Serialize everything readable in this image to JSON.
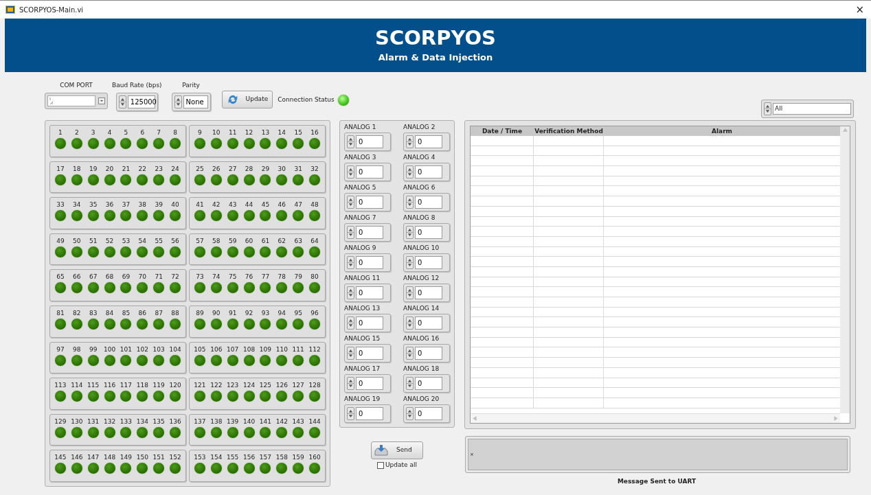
{
  "window": {
    "title": "SCORPYOS-Main.vi",
    "close": "×"
  },
  "header": {
    "title": "SCORPYOS",
    "subtitle": "Alarm & Data Injection"
  },
  "serial": {
    "com_port": {
      "label": "COM PORT"
    },
    "baud_rate": {
      "label": "Baud Rate (bps)",
      "value": "125000"
    },
    "parity": {
      "label": "Parity",
      "value": "None"
    },
    "update_button": "Update",
    "connection_status": {
      "label": "Connection Status",
      "on": true
    }
  },
  "led_groups": [
    {
      "leds": [
        {
          "label": "1",
          "on": false
        },
        {
          "label": "2",
          "on": false
        },
        {
          "label": "3",
          "on": false
        },
        {
          "label": "4",
          "on": false
        },
        {
          "label": "5",
          "on": false
        },
        {
          "label": "6",
          "on": false
        },
        {
          "label": "7",
          "on": false
        },
        {
          "label": "8",
          "on": false
        }
      ]
    },
    {
      "leds": [
        {
          "label": "9",
          "on": false
        },
        {
          "label": "10",
          "on": false
        },
        {
          "label": "11",
          "on": false
        },
        {
          "label": "12",
          "on": false
        },
        {
          "label": "13",
          "on": false
        },
        {
          "label": "14",
          "on": false
        },
        {
          "label": "15",
          "on": false
        },
        {
          "label": "16",
          "on": false
        }
      ]
    },
    {
      "leds": [
        {
          "label": "17",
          "on": false
        },
        {
          "label": "18",
          "on": false
        },
        {
          "label": "19",
          "on": false
        },
        {
          "label": "20",
          "on": false
        },
        {
          "label": "21",
          "on": false
        },
        {
          "label": "22",
          "on": false
        },
        {
          "label": "23",
          "on": false
        },
        {
          "label": "24",
          "on": false
        }
      ]
    },
    {
      "leds": [
        {
          "label": "25",
          "on": false
        },
        {
          "label": "26",
          "on": false
        },
        {
          "label": "27",
          "on": false
        },
        {
          "label": "28",
          "on": false
        },
        {
          "label": "29",
          "on": false
        },
        {
          "label": "30",
          "on": false
        },
        {
          "label": "31",
          "on": false
        },
        {
          "label": "32",
          "on": false
        }
      ]
    },
    {
      "leds": [
        {
          "label": "33",
          "on": false
        },
        {
          "label": "34",
          "on": false
        },
        {
          "label": "35",
          "on": false
        },
        {
          "label": "36",
          "on": false
        },
        {
          "label": "37",
          "on": false
        },
        {
          "label": "38",
          "on": false
        },
        {
          "label": "39",
          "on": false
        },
        {
          "label": "40",
          "on": false
        }
      ]
    },
    {
      "leds": [
        {
          "label": "41",
          "on": false
        },
        {
          "label": "42",
          "on": false
        },
        {
          "label": "43",
          "on": false
        },
        {
          "label": "44",
          "on": false
        },
        {
          "label": "45",
          "on": false
        },
        {
          "label": "46",
          "on": false
        },
        {
          "label": "47",
          "on": false
        },
        {
          "label": "48",
          "on": false
        }
      ]
    },
    {
      "leds": [
        {
          "label": "49",
          "on": false
        },
        {
          "label": "50",
          "on": false
        },
        {
          "label": "51",
          "on": false
        },
        {
          "label": "52",
          "on": false
        },
        {
          "label": "53",
          "on": false
        },
        {
          "label": "54",
          "on": false
        },
        {
          "label": "55",
          "on": false
        },
        {
          "label": "56",
          "on": false
        }
      ]
    },
    {
      "leds": [
        {
          "label": "57",
          "on": false
        },
        {
          "label": "58",
          "on": false
        },
        {
          "label": "59",
          "on": false
        },
        {
          "label": "60",
          "on": false
        },
        {
          "label": "61",
          "on": false
        },
        {
          "label": "62",
          "on": false
        },
        {
          "label": "63",
          "on": false
        },
        {
          "label": "64",
          "on": false
        }
      ]
    },
    {
      "leds": [
        {
          "label": "65",
          "on": false
        },
        {
          "label": "66",
          "on": false
        },
        {
          "label": "67",
          "on": false
        },
        {
          "label": "68",
          "on": false
        },
        {
          "label": "69",
          "on": false
        },
        {
          "label": "70",
          "on": false
        },
        {
          "label": "71",
          "on": false
        },
        {
          "label": "72",
          "on": false
        }
      ]
    },
    {
      "leds": [
        {
          "label": "73",
          "on": false
        },
        {
          "label": "74",
          "on": false
        },
        {
          "label": "75",
          "on": false
        },
        {
          "label": "76",
          "on": false
        },
        {
          "label": "77",
          "on": false
        },
        {
          "label": "78",
          "on": false
        },
        {
          "label": "79",
          "on": false
        },
        {
          "label": "80",
          "on": false
        }
      ]
    },
    {
      "leds": [
        {
          "label": "81",
          "on": false
        },
        {
          "label": "82",
          "on": false
        },
        {
          "label": "83",
          "on": false
        },
        {
          "label": "84",
          "on": false
        },
        {
          "label": "85",
          "on": false
        },
        {
          "label": "86",
          "on": false
        },
        {
          "label": "87",
          "on": false
        },
        {
          "label": "88",
          "on": false
        }
      ]
    },
    {
      "leds": [
        {
          "label": "89",
          "on": false
        },
        {
          "label": "90",
          "on": false
        },
        {
          "label": "91",
          "on": false
        },
        {
          "label": "92",
          "on": false
        },
        {
          "label": "93",
          "on": false
        },
        {
          "label": "94",
          "on": false
        },
        {
          "label": "95",
          "on": false
        },
        {
          "label": "96",
          "on": false
        }
      ]
    },
    {
      "leds": [
        {
          "label": "97",
          "on": false
        },
        {
          "label": "98",
          "on": false
        },
        {
          "label": "99",
          "on": false
        },
        {
          "label": "100",
          "on": false
        },
        {
          "label": "101",
          "on": false
        },
        {
          "label": "102",
          "on": false
        },
        {
          "label": "103",
          "on": false
        },
        {
          "label": "104",
          "on": false
        }
      ]
    },
    {
      "leds": [
        {
          "label": "105",
          "on": false
        },
        {
          "label": "106",
          "on": false
        },
        {
          "label": "107",
          "on": false
        },
        {
          "label": "108",
          "on": false
        },
        {
          "label": "109",
          "on": false
        },
        {
          "label": "110",
          "on": false
        },
        {
          "label": "111",
          "on": false
        },
        {
          "label": "112",
          "on": false
        }
      ]
    },
    {
      "leds": [
        {
          "label": "113",
          "on": false
        },
        {
          "label": "114",
          "on": false
        },
        {
          "label": "115",
          "on": false
        },
        {
          "label": "116",
          "on": false
        },
        {
          "label": "117",
          "on": false
        },
        {
          "label": "118",
          "on": false
        },
        {
          "label": "119",
          "on": false
        },
        {
          "label": "120",
          "on": false
        }
      ]
    },
    {
      "leds": [
        {
          "label": "121",
          "on": false
        },
        {
          "label": "122",
          "on": false
        },
        {
          "label": "123",
          "on": false
        },
        {
          "label": "124",
          "on": false
        },
        {
          "label": "125",
          "on": false
        },
        {
          "label": "126",
          "on": false
        },
        {
          "label": "127",
          "on": false
        },
        {
          "label": "128",
          "on": false
        }
      ]
    },
    {
      "leds": [
        {
          "label": "129",
          "on": false
        },
        {
          "label": "130",
          "on": false
        },
        {
          "label": "131",
          "on": false
        },
        {
          "label": "132",
          "on": false
        },
        {
          "label": "133",
          "on": false
        },
        {
          "label": "134",
          "on": false
        },
        {
          "label": "135",
          "on": false
        },
        {
          "label": "136",
          "on": false
        }
      ]
    },
    {
      "leds": [
        {
          "label": "137",
          "on": false
        },
        {
          "label": "138",
          "on": false
        },
        {
          "label": "139",
          "on": false
        },
        {
          "label": "140",
          "on": false
        },
        {
          "label": "141",
          "on": false
        },
        {
          "label": "142",
          "on": false
        },
        {
          "label": "143",
          "on": false
        },
        {
          "label": "144",
          "on": false
        }
      ]
    },
    {
      "leds": [
        {
          "label": "145",
          "on": false
        },
        {
          "label": "146",
          "on": false
        },
        {
          "label": "147",
          "on": false
        },
        {
          "label": "148",
          "on": false
        },
        {
          "label": "149",
          "on": false
        },
        {
          "label": "150",
          "on": false
        },
        {
          "label": "151",
          "on": false
        },
        {
          "label": "152",
          "on": false
        }
      ]
    },
    {
      "leds": [
        {
          "label": "153",
          "on": false
        },
        {
          "label": "154",
          "on": false
        },
        {
          "label": "155",
          "on": false
        },
        {
          "label": "156",
          "on": false
        },
        {
          "label": "157",
          "on": false
        },
        {
          "label": "158",
          "on": false
        },
        {
          "label": "159",
          "on": false
        },
        {
          "label": "160",
          "on": false
        }
      ]
    }
  ],
  "analogs": [
    {
      "label": "ANALOG 1",
      "value": "0"
    },
    {
      "label": "ANALOG 2",
      "value": "0"
    },
    {
      "label": "ANALOG 3",
      "value": "0"
    },
    {
      "label": "ANALOG 4",
      "value": "0"
    },
    {
      "label": "ANALOG 5",
      "value": "0"
    },
    {
      "label": "ANALOG 6",
      "value": "0"
    },
    {
      "label": "ANALOG 7",
      "value": "0"
    },
    {
      "label": "ANALOG 8",
      "value": "0"
    },
    {
      "label": "ANALOG 9",
      "value": "0"
    },
    {
      "label": "ANALOG 10",
      "value": "0"
    },
    {
      "label": "ANALOG 11",
      "value": "0"
    },
    {
      "label": "ANALOG 12",
      "value": "0"
    },
    {
      "label": "ANALOG 13",
      "value": "0"
    },
    {
      "label": "ANALOG 14",
      "value": "0"
    },
    {
      "label": "ANALOG 15",
      "value": "0"
    },
    {
      "label": "ANALOG 16",
      "value": "0"
    },
    {
      "label": "ANALOG 17",
      "value": "0"
    },
    {
      "label": "ANALOG 18",
      "value": "0"
    },
    {
      "label": "ANALOG 19",
      "value": "0"
    },
    {
      "label": "ANALOG 20",
      "value": "0"
    }
  ],
  "send_button": "Send",
  "update_all": {
    "label": "Update all",
    "checked": false
  },
  "filter": {
    "value": "All"
  },
  "table": {
    "columns": [
      "Date / Time",
      "Verification Method",
      "Alarm"
    ]
  },
  "message": {
    "marker": "×",
    "label": "Message Sent to UART"
  }
}
